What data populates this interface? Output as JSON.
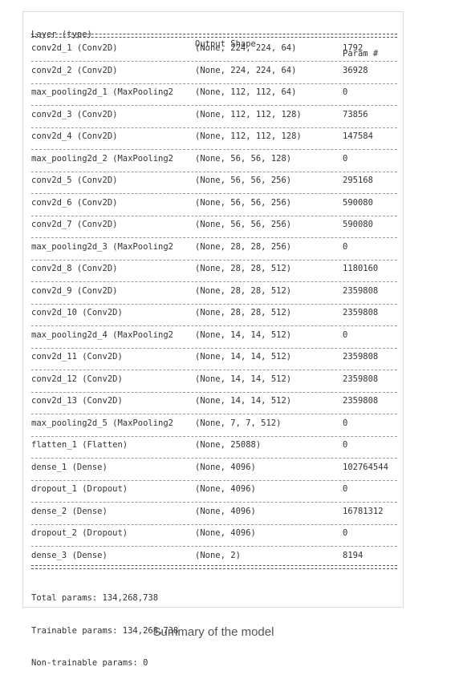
{
  "header": {
    "layer": "Layer (type)",
    "shape": "Output Shape",
    "params": "Param #"
  },
  "rows": [
    {
      "layer": "conv2d_1 (Conv2D)",
      "shape": "(None, 224, 224, 64)",
      "params": "1792"
    },
    {
      "layer": "conv2d_2 (Conv2D)",
      "shape": "(None, 224, 224, 64)",
      "params": "36928"
    },
    {
      "layer": "max_pooling2d_1 (MaxPooling2",
      "shape": "(None, 112, 112, 64)",
      "params": "0"
    },
    {
      "layer": "conv2d_3 (Conv2D)",
      "shape": "(None, 112, 112, 128)",
      "params": "73856"
    },
    {
      "layer": "conv2d_4 (Conv2D)",
      "shape": "(None, 112, 112, 128)",
      "params": "147584"
    },
    {
      "layer": "max_pooling2d_2 (MaxPooling2",
      "shape": "(None, 56, 56, 128)",
      "params": "0"
    },
    {
      "layer": "conv2d_5 (Conv2D)",
      "shape": "(None, 56, 56, 256)",
      "params": "295168"
    },
    {
      "layer": "conv2d_6 (Conv2D)",
      "shape": "(None, 56, 56, 256)",
      "params": "590080"
    },
    {
      "layer": "conv2d_7 (Conv2D)",
      "shape": "(None, 56, 56, 256)",
      "params": "590080"
    },
    {
      "layer": "max_pooling2d_3 (MaxPooling2",
      "shape": "(None, 28, 28, 256)",
      "params": "0"
    },
    {
      "layer": "conv2d_8 (Conv2D)",
      "shape": "(None, 28, 28, 512)",
      "params": "1180160"
    },
    {
      "layer": "conv2d_9 (Conv2D)",
      "shape": "(None, 28, 28, 512)",
      "params": "2359808"
    },
    {
      "layer": "conv2d_10 (Conv2D)",
      "shape": "(None, 28, 28, 512)",
      "params": "2359808"
    },
    {
      "layer": "max_pooling2d_4 (MaxPooling2",
      "shape": "(None, 14, 14, 512)",
      "params": "0"
    },
    {
      "layer": "conv2d_11 (Conv2D)",
      "shape": "(None, 14, 14, 512)",
      "params": "2359808"
    },
    {
      "layer": "conv2d_12 (Conv2D)",
      "shape": "(None, 14, 14, 512)",
      "params": "2359808"
    },
    {
      "layer": "conv2d_13 (Conv2D)",
      "shape": "(None, 14, 14, 512)",
      "params": "2359808"
    },
    {
      "layer": "max_pooling2d_5 (MaxPooling2",
      "shape": "(None, 7, 7, 512)",
      "params": "0"
    },
    {
      "layer": "flatten_1 (Flatten)",
      "shape": "(None, 25088)",
      "params": "0"
    },
    {
      "layer": "dense_1 (Dense)",
      "shape": "(None, 4096)",
      "params": "102764544"
    },
    {
      "layer": "dropout_1 (Dropout)",
      "shape": "(None, 4096)",
      "params": "0"
    },
    {
      "layer": "dense_2 (Dense)",
      "shape": "(None, 4096)",
      "params": "16781312"
    },
    {
      "layer": "dropout_2 (Dropout)",
      "shape": "(None, 4096)",
      "params": "0"
    },
    {
      "layer": "dense_3 (Dense)",
      "shape": "(None, 2)",
      "params": "8194"
    }
  ],
  "totals": {
    "total": "Total params: 134,268,738",
    "trainable": "Trainable params: 134,268,738",
    "non_trainable": "Non-trainable params: 0"
  },
  "caption": "Summary of the model"
}
